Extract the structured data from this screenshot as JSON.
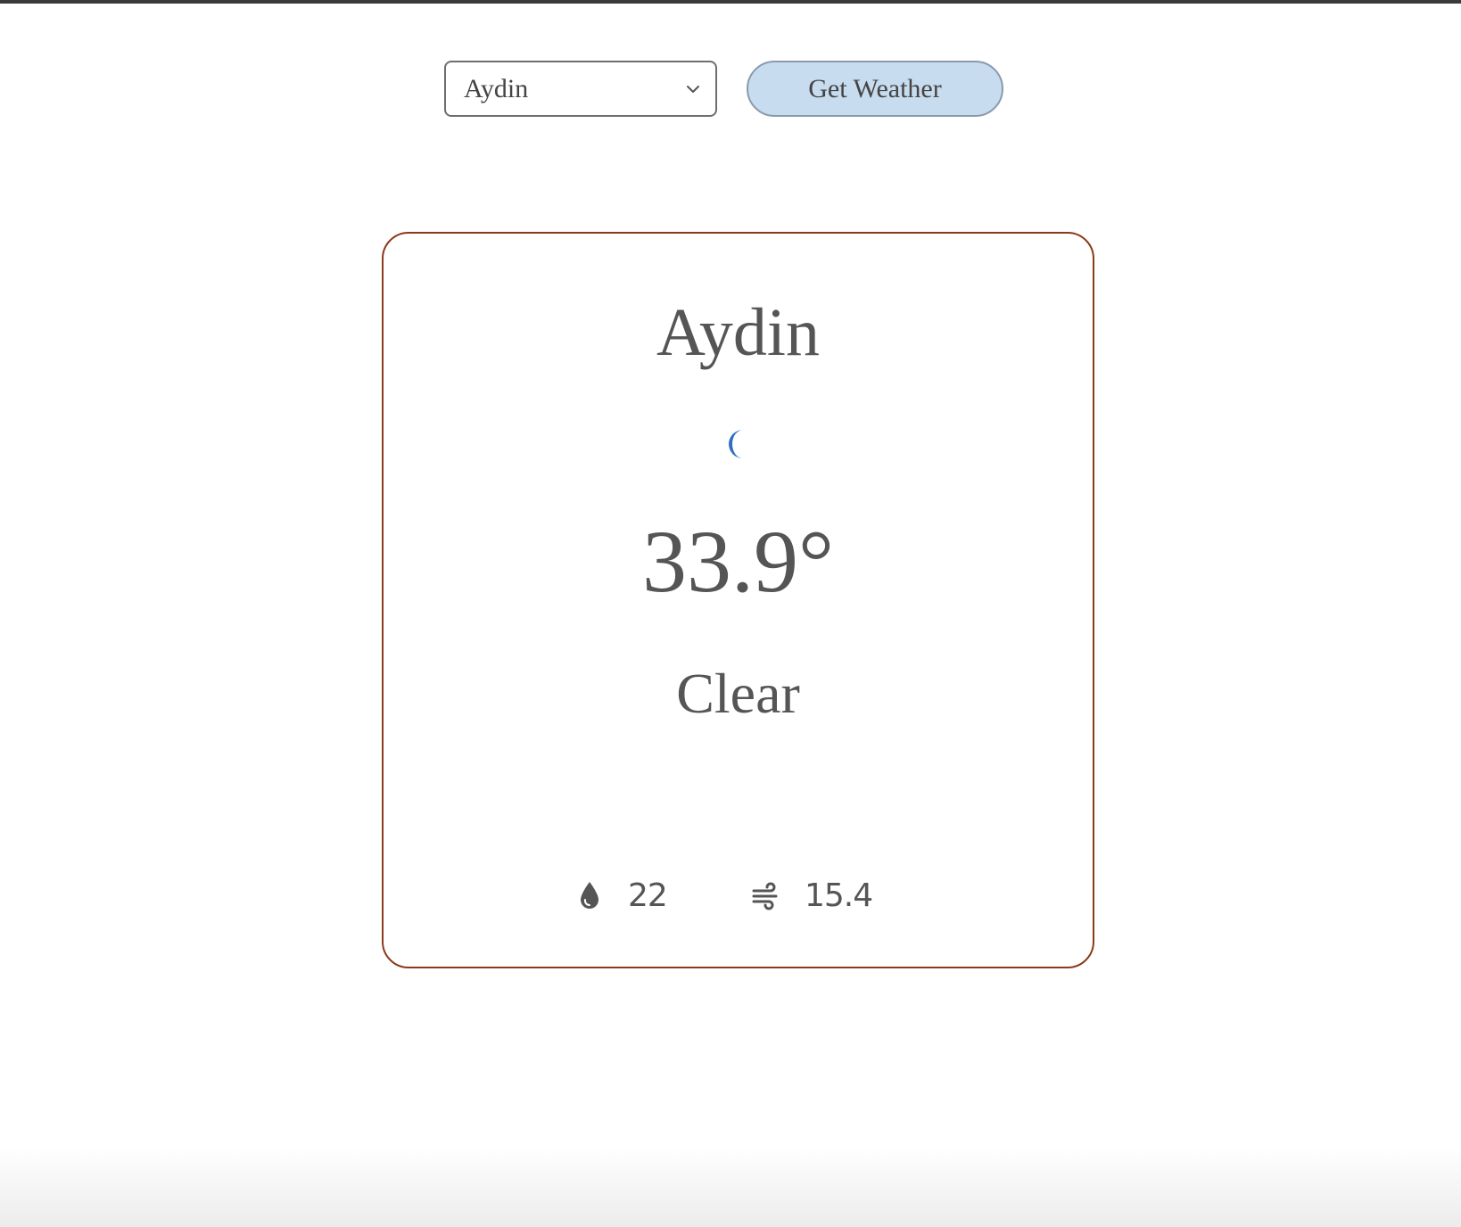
{
  "controls": {
    "selected_city": "Aydin",
    "button_label": "Get Weather"
  },
  "weather": {
    "city": "Aydin",
    "icon": "moon-icon",
    "temperature": "33.9°",
    "condition": "Clear",
    "humidity": "22",
    "humidity_icon": "water-drop-icon",
    "wind": "15.4",
    "wind_icon": "wind-icon"
  },
  "colors": {
    "button_bg": "#c7dcef",
    "card_border": "#8b3a1a",
    "icon_blue": "#2f6fc1",
    "text": "#555555"
  }
}
